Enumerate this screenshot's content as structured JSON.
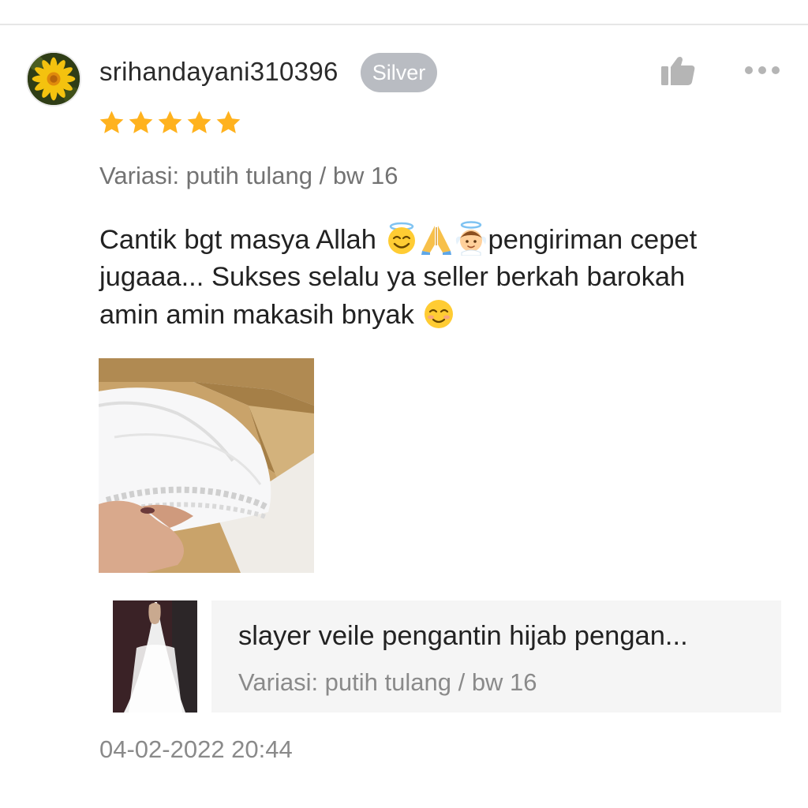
{
  "review": {
    "username": "srihandayani310396",
    "tier_badge": "Silver",
    "rating": 5,
    "rating_max": 5,
    "variation": "Variasi: putih tulang / bw 16",
    "text_part1": "Cantik bgt masya Allah ",
    "emoji1": "smiling-face-with-halo",
    "emoji2": "folded-hands",
    "emoji3": "baby-angel",
    "text_part2": "pengiriman cepet jugaaa... Sukses selalu ya seller berkah barokah amin amin makasih bnyak ",
    "emoji4": "smiling-face",
    "photo_icon": "review-photo",
    "timestamp": "04-02-2022 20:44"
  },
  "product": {
    "name": "slayer veile pengantin hijab pengan...",
    "variation": "Variasi: putih tulang / bw 16"
  },
  "actions": {
    "like_icon": "thumbs-up-icon",
    "more_icon": "more-dots-icon"
  },
  "colors": {
    "star": "#ffb21e",
    "badge": "#b9bcc2",
    "icon_gray": "#b5b5b5",
    "text_muted": "#737373",
    "product_bg": "#f5f5f5"
  }
}
